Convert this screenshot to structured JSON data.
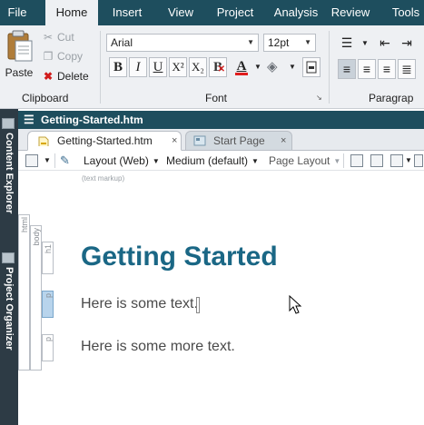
{
  "menu": {
    "items": [
      "File",
      "Home",
      "Insert",
      "View",
      "Project",
      "Analysis",
      "Review",
      "Tools"
    ],
    "active": "Home"
  },
  "clipboard": {
    "label": "Clipboard",
    "paste": "Paste",
    "cut": "Cut",
    "copy": "Copy",
    "delete": "Delete"
  },
  "font": {
    "label": "Font",
    "family": "Arial",
    "size": "12pt",
    "buttons": {
      "bold": "B",
      "italic": "I",
      "underline": "U",
      "superscript": "X²",
      "subscript": "X₂",
      "clear": "B",
      "font_color": "A"
    },
    "font_color_hex": "#e01e1e"
  },
  "paragraph": {
    "label": "Paragrap"
  },
  "document": {
    "title": "Getting-Started.htm"
  },
  "sidebar": {
    "content_explorer": "Content Explorer",
    "project_organizer": "Project Organizer"
  },
  "tabs": [
    {
      "label": "Getting-Started.htm",
      "close": "×"
    },
    {
      "label": "Start Page",
      "close": "×"
    }
  ],
  "toolbar": {
    "layout": "Layout (Web)",
    "medium": "Medium (default)",
    "page_layout": "Page Layout"
  },
  "editor": {
    "hint": "(text markup)",
    "structure": {
      "html": "html",
      "body": "body",
      "h1": "h1",
      "p1": "p",
      "p2": "p"
    },
    "heading": "Getting Started",
    "paragraph1": "Here is some text.",
    "paragraph2": "Here is some more text."
  },
  "colors": {
    "menubar": "#1e4e5e",
    "heading": "#1a6785",
    "ribbon": "#eef0f3",
    "side_dock": "#2d3b45"
  }
}
